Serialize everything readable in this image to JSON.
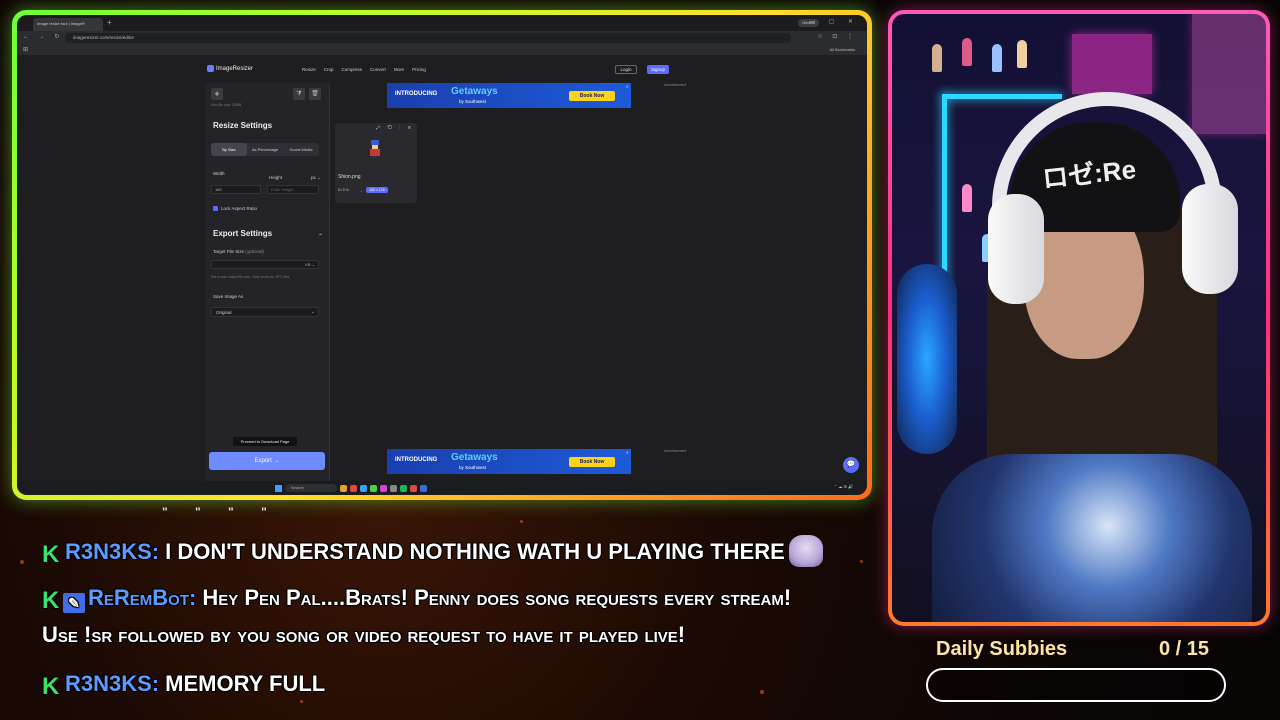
{
  "browser": {
    "tab_title": "Image resize tool | ImageR",
    "gemini_label": "Gemini",
    "url": "imageresizer.com/resize/editor",
    "bookmarks_label": "All Bookmarks"
  },
  "site": {
    "logo": "ImageResizer",
    "menu": [
      "Resize",
      "Crop",
      "Compress",
      "Convert",
      "More",
      "Pricing"
    ],
    "login": "Login",
    "signup": "Signup"
  },
  "sidebar": {
    "max_note": "Max file size: 20MB",
    "resize_title": "Resize Settings",
    "resize_modes": [
      "By Size",
      "As Percentage",
      "Social Media"
    ],
    "width_label": "Width",
    "height_label": "Height",
    "unit": "px",
    "width_value": "180",
    "height_placeholder": "Enter Height",
    "lock_label": "Lock Aspect Ratio",
    "export_title": "Export Settings",
    "target_label": "Target File Size",
    "target_optional": "(optional)",
    "target_unit": "KB",
    "target_hint": "Set a max output file size. Only works for JPG files",
    "save_as_label": "Save Image As",
    "save_as_value": "Original",
    "tooltip": "Proceed to Download Page",
    "export_button": "Export →"
  },
  "ads": {
    "intro": "INTRODUCING",
    "brand": "Getaways",
    "by": "by Southwest",
    "cta": "Book Now",
    "label": "Advertisement"
  },
  "file": {
    "name": "Shion.png",
    "size": "61.5 %",
    "new_size": "180 x 126"
  },
  "taskbar": {
    "search": "Search"
  },
  "chat": {
    "marks": "\" \" \" \"",
    "messages": [
      {
        "user": "R3N3KS:",
        "text": "I DON'T UNDERSTAND NOTHING WATH U PLAYING THERE",
        "badge": "k",
        "emote": true
      },
      {
        "user": "ReRemBot:",
        "text": "Hey Pen Pal....Brats! Penny does song requests every stream!",
        "badge": "k-bot",
        "emote": false
      },
      {
        "user": "",
        "text": "Use !sr followed by you song or video request to have it played live!",
        "badge": "",
        "emote": false
      },
      {
        "user": "R3N3KS:",
        "text": "MEMORY FULL",
        "badge": "k",
        "emote": false
      }
    ]
  },
  "cam": {
    "beanie_text": "ロゼ:Re"
  },
  "goal": {
    "title": "Daily Subbies",
    "count": "0 / 15",
    "progress": 0
  },
  "colors": {
    "accent": "#5b6bff",
    "frame_green": "#6dff3a",
    "frame_pink": "#ff5ab8",
    "goal_gold": "#ffe4a6"
  }
}
